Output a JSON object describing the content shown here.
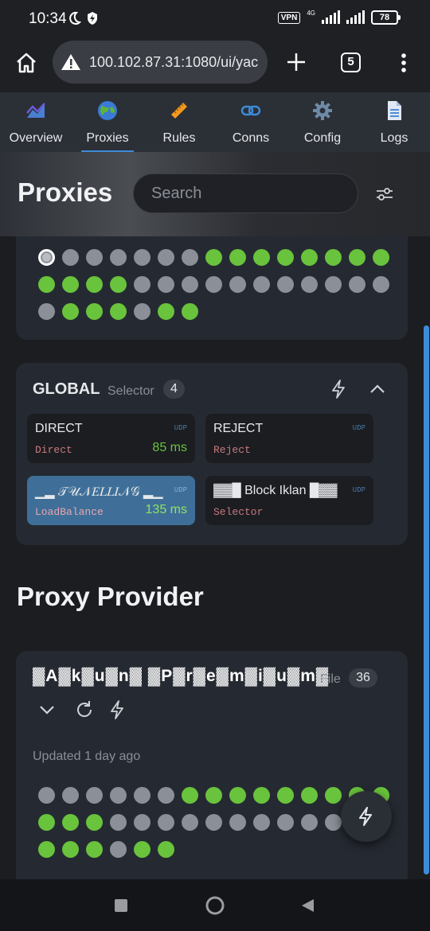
{
  "status_bar": {
    "time": "10:34",
    "vpn": "VPN",
    "network": "4G",
    "battery": "78"
  },
  "browser": {
    "url": "100.102.87.31:1080/ui/yac",
    "tab_count": "5"
  },
  "nav": {
    "items": [
      {
        "label": "Overview",
        "icon": "chart-icon"
      },
      {
        "label": "Proxies",
        "icon": "globe-icon",
        "active": true
      },
      {
        "label": "Rules",
        "icon": "ruler-icon"
      },
      {
        "label": "Conns",
        "icon": "link-icon"
      },
      {
        "label": "Config",
        "icon": "gear-icon"
      },
      {
        "label": "Logs",
        "icon": "document-icon"
      }
    ]
  },
  "header": {
    "title": "Proxies",
    "search_placeholder": "Search"
  },
  "top_group": {
    "dot_status": [
      "selected",
      "n",
      "n",
      "n",
      "n",
      "n",
      "n",
      "g",
      "g",
      "g",
      "g",
      "g",
      "g",
      "g",
      "g",
      "g",
      "g",
      "g",
      "g",
      "n",
      "n",
      "n",
      "n",
      "n",
      "n",
      "n",
      "n",
      "n",
      "n",
      "n",
      "n",
      "g",
      "g",
      "g",
      "n",
      "g",
      "g"
    ]
  },
  "global_group": {
    "name": "GLOBAL",
    "type": "Selector",
    "count": "4",
    "proxies": [
      {
        "name": "DIRECT",
        "udp": "UDP",
        "type": "Direct",
        "latency": "85 ms",
        "active": false
      },
      {
        "name": "REJECT",
        "udp": "UDP",
        "type": "Reject",
        "latency": "",
        "active": false
      },
      {
        "name": "▁▂ 𝒯𝒰𝒩𝐸𝐿𝐿𝐼𝒩𝒢 ▂▁",
        "udp": "UDP",
        "type": "LoadBalance",
        "latency": "135 ms",
        "active": true
      },
      {
        "name": "▓▓█ Block Iklan █▓▓",
        "udp": "UDP",
        "type": "Selector",
        "latency": "",
        "active": false
      }
    ]
  },
  "provider_section": {
    "title": "Proxy Provider"
  },
  "provider": {
    "name": "▓A▓k▓u▓n▓ ▓P▓r▓e▓m▓i▓u▓m▓",
    "type": "File",
    "count": "36",
    "updated": "Updated 1 day ago",
    "dot_status": [
      "n",
      "n",
      "n",
      "n",
      "n",
      "n",
      "g",
      "g",
      "g",
      "g",
      "g",
      "g",
      "g",
      "g",
      "g",
      "g",
      "g",
      "g",
      "n",
      "n",
      "n",
      "n",
      "n",
      "n",
      "n",
      "n",
      "n",
      "n",
      "n",
      "n",
      "g",
      "g",
      "g",
      "n",
      "g",
      "g"
    ]
  },
  "colors": {
    "accent": "#3d8bd9",
    "good": "#69c33c",
    "neutral": "#8a8f98",
    "card": "#252a32"
  }
}
